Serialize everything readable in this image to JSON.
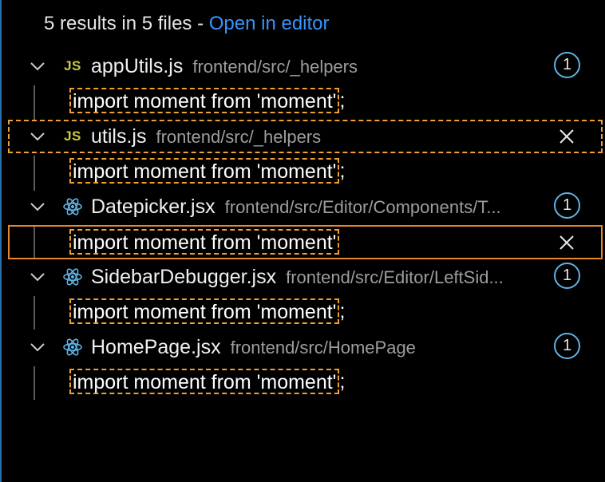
{
  "summary": {
    "count_text": "5 results in 5 files - ",
    "open_link": "Open in editor"
  },
  "results": [
    {
      "file": "appUtils.js",
      "path": "frontend/src/_helpers",
      "icon": "js-icon",
      "icon_text": "JS",
      "badge": "1",
      "match": "import moment from 'moment'",
      "match_suffix": ";"
    },
    {
      "file": "utils.js",
      "path": "frontend/src/_helpers",
      "icon": "js-icon",
      "icon_text": "JS",
      "close": "×",
      "match": "import moment from 'moment'",
      "match_suffix": ";"
    },
    {
      "file": "Datepicker.jsx",
      "path": "frontend/src/Editor/Components/T...",
      "icon": "react-icon",
      "badge": "1",
      "match": "import moment from 'moment'",
      "match_suffix": "",
      "close": "×"
    },
    {
      "file": "SidebarDebugger.jsx",
      "path": "frontend/src/Editor/LeftSid...",
      "icon": "react-icon",
      "badge": "1",
      "match": "import moment from 'moment'",
      "match_suffix": ";"
    },
    {
      "file": "HomePage.jsx",
      "path": "frontend/src/HomePage",
      "icon": "react-icon",
      "badge": "1",
      "match": "import moment from 'moment'",
      "match_suffix": ";"
    }
  ],
  "colors": {
    "background": "#000000",
    "link": "#3794ff",
    "highlight_border": "#f0a12e",
    "badge_border": "#5fb3e6",
    "js_icon": "#cbcb41",
    "react_icon": "#5fb3e6"
  }
}
